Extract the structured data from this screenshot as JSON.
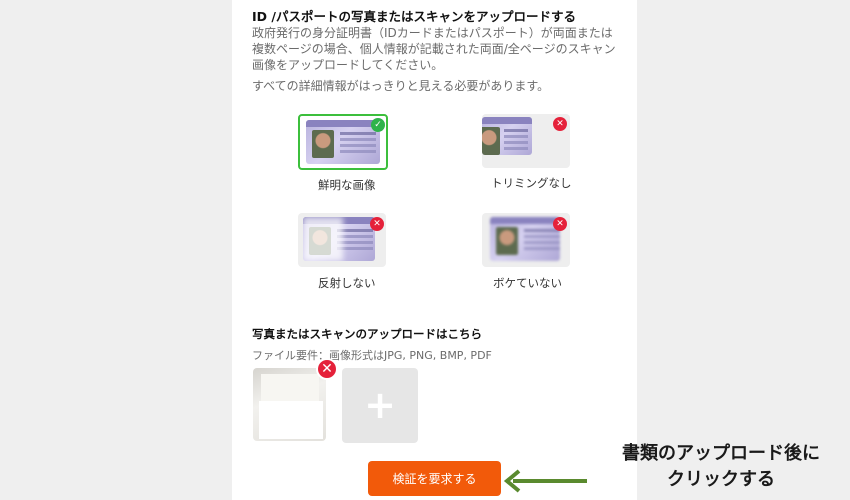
{
  "section": {
    "heading": "ID /パスポートの写真またはスキャンをアップロードする",
    "description": "政府発行の身分証明書（IDカードまたはパスポート）が両面または複数ページの場合、個人情報が記載された両面/全ページのスキャン画像をアップロードしてください。",
    "requirement": "すべての詳細情報がはっきりと見える必要があります。"
  },
  "samples": [
    {
      "caption": "鮮明な画像",
      "status": "good",
      "icon": "check-icon"
    },
    {
      "caption": "トリミングなし",
      "status": "bad",
      "icon": "close-icon"
    },
    {
      "caption": "反射しない",
      "status": "bad",
      "icon": "close-icon"
    },
    {
      "caption": "ボケていない",
      "status": "bad",
      "icon": "close-icon"
    }
  ],
  "upload": {
    "title": "写真またはスキャンのアップロードはこちら",
    "file_requirements": "ファイル要件：画像形式はJPG, PNG, BMP, PDF",
    "remove_icon": "close-icon",
    "add_icon": "plus-icon"
  },
  "verify_button": {
    "label": "検証を要求する"
  },
  "annotation": {
    "line1": "書類のアップロード後に",
    "line2": "クリックする"
  },
  "colors": {
    "accent": "#f25a0a",
    "good": "#2fb34a",
    "bad": "#e5213a",
    "arrow": "#5a8a2e"
  }
}
